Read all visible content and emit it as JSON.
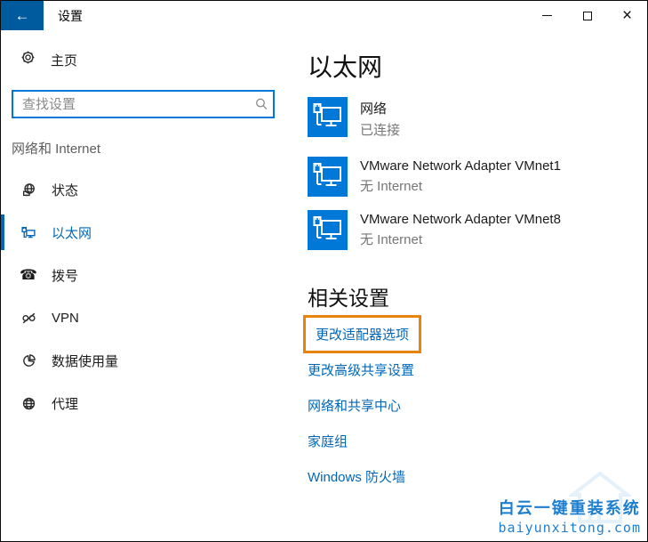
{
  "titlebar": {
    "title": "设置",
    "back_glyph": "←",
    "close_glyph": "×"
  },
  "sidebar": {
    "home_label": "主页",
    "search_placeholder": "查找设置",
    "section_label": "网络和 Internet",
    "items": [
      {
        "label": "状态",
        "icon": "status-globe-icon",
        "selected": false
      },
      {
        "label": "以太网",
        "icon": "ethernet-icon",
        "selected": true
      },
      {
        "label": "拨号",
        "icon": "dialup-phone-icon",
        "selected": false,
        "glyph": "☎"
      },
      {
        "label": "VPN",
        "icon": "vpn-icon",
        "selected": false
      },
      {
        "label": "数据使用量",
        "icon": "data-usage-pie-icon",
        "selected": false
      },
      {
        "label": "代理",
        "icon": "proxy-globe-icon",
        "selected": false
      }
    ]
  },
  "main": {
    "title": "以太网",
    "connections": [
      {
        "name": "网络",
        "status": "已连接"
      },
      {
        "name": "VMware Network Adapter VMnet1",
        "status": "无 Internet"
      },
      {
        "name": "VMware Network Adapter VMnet8",
        "status": "无 Internet"
      }
    ],
    "related": {
      "title": "相关设置",
      "links": [
        {
          "label": "更改适配器选项",
          "highlighted": true
        },
        {
          "label": "更改高级共享设置",
          "highlighted": false
        },
        {
          "label": "网络和共享中心",
          "highlighted": false
        },
        {
          "label": "家庭组",
          "highlighted": false
        },
        {
          "label": "Windows 防火墙",
          "highlighted": false
        }
      ]
    }
  },
  "watermark": {
    "line1": "白云一键重装系统",
    "line2": "baiyunxitong.com"
  },
  "colors": {
    "accent_link": "#0067b8",
    "tile_blue": "#0078d7",
    "titlebar_back_bg": "#005a9e",
    "highlight_border_orange": "#e8830c",
    "muted_text": "#767676",
    "search_border": "#0078d7"
  }
}
